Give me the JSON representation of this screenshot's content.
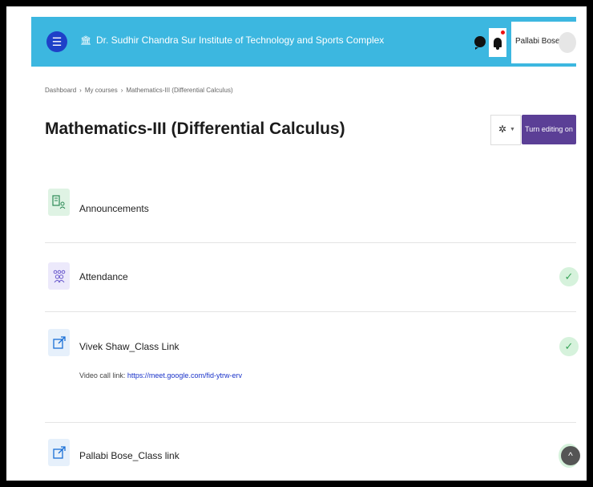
{
  "header": {
    "menu_icon": "menu-icon",
    "building_icon": "institution-icon",
    "site_name": "Dr. Sudhir Chandra Sur Institute of Technology and Sports Complex",
    "user_name": "Pallabi Bose"
  },
  "breadcrumb": [
    "Dashboard",
    "My courses",
    "Mathematics-III (Differential Calculus)"
  ],
  "page_title": "Mathematics-III (Differential Calculus)",
  "buttons": {
    "edit": "Turn editing on"
  },
  "colors": {
    "header": "#3cb7e0",
    "accent": "#5b3f96",
    "done": "#3aa55a",
    "link": "#1a33c9"
  },
  "activities": [
    {
      "label": "Announcements",
      "icon": "forum-icon",
      "completed": false
    },
    {
      "label": "Attendance",
      "icon": "attendance-icon",
      "completed": true
    },
    {
      "label": "Vivek Shaw_Class Link",
      "icon": "url-icon",
      "completed": true,
      "desc_prefix": "Video call link:",
      "desc_link": "https://meet.google.com/fid-ytrw-erv"
    },
    {
      "label": "Pallabi Bose_Class link",
      "icon": "url-icon",
      "completed": true
    }
  ]
}
